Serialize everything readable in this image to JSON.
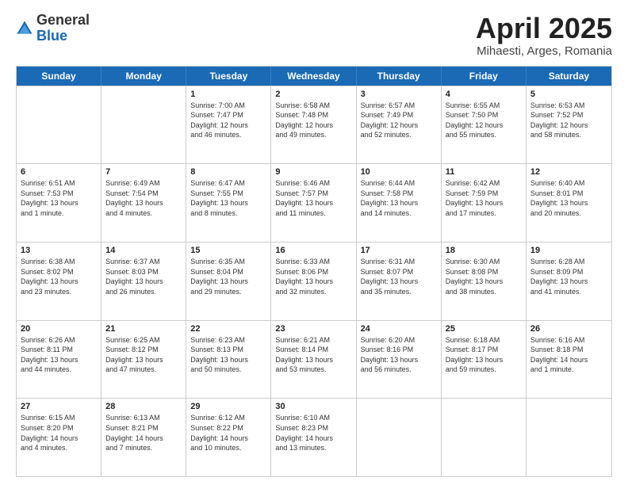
{
  "header": {
    "logo_general": "General",
    "logo_blue": "Blue",
    "month_title": "April 2025",
    "location": "Mihaesti, Arges, Romania"
  },
  "days_of_week": [
    "Sunday",
    "Monday",
    "Tuesday",
    "Wednesday",
    "Thursday",
    "Friday",
    "Saturday"
  ],
  "weeks": [
    [
      {
        "day": "",
        "empty": true
      },
      {
        "day": "",
        "empty": true
      },
      {
        "day": "1",
        "line1": "Sunrise: 7:00 AM",
        "line2": "Sunset: 7:47 PM",
        "line3": "Daylight: 12 hours",
        "line4": "and 46 minutes."
      },
      {
        "day": "2",
        "line1": "Sunrise: 6:58 AM",
        "line2": "Sunset: 7:48 PM",
        "line3": "Daylight: 12 hours",
        "line4": "and 49 minutes."
      },
      {
        "day": "3",
        "line1": "Sunrise: 6:57 AM",
        "line2": "Sunset: 7:49 PM",
        "line3": "Daylight: 12 hours",
        "line4": "and 52 minutes."
      },
      {
        "day": "4",
        "line1": "Sunrise: 6:55 AM",
        "line2": "Sunset: 7:50 PM",
        "line3": "Daylight: 12 hours",
        "line4": "and 55 minutes."
      },
      {
        "day": "5",
        "line1": "Sunrise: 6:53 AM",
        "line2": "Sunset: 7:52 PM",
        "line3": "Daylight: 12 hours",
        "line4": "and 58 minutes."
      }
    ],
    [
      {
        "day": "6",
        "line1": "Sunrise: 6:51 AM",
        "line2": "Sunset: 7:53 PM",
        "line3": "Daylight: 13 hours",
        "line4": "and 1 minute."
      },
      {
        "day": "7",
        "line1": "Sunrise: 6:49 AM",
        "line2": "Sunset: 7:54 PM",
        "line3": "Daylight: 13 hours",
        "line4": "and 4 minutes."
      },
      {
        "day": "8",
        "line1": "Sunrise: 6:47 AM",
        "line2": "Sunset: 7:55 PM",
        "line3": "Daylight: 13 hours",
        "line4": "and 8 minutes."
      },
      {
        "day": "9",
        "line1": "Sunrise: 6:46 AM",
        "line2": "Sunset: 7:57 PM",
        "line3": "Daylight: 13 hours",
        "line4": "and 11 minutes."
      },
      {
        "day": "10",
        "line1": "Sunrise: 6:44 AM",
        "line2": "Sunset: 7:58 PM",
        "line3": "Daylight: 13 hours",
        "line4": "and 14 minutes."
      },
      {
        "day": "11",
        "line1": "Sunrise: 6:42 AM",
        "line2": "Sunset: 7:59 PM",
        "line3": "Daylight: 13 hours",
        "line4": "and 17 minutes."
      },
      {
        "day": "12",
        "line1": "Sunrise: 6:40 AM",
        "line2": "Sunset: 8:01 PM",
        "line3": "Daylight: 13 hours",
        "line4": "and 20 minutes."
      }
    ],
    [
      {
        "day": "13",
        "line1": "Sunrise: 6:38 AM",
        "line2": "Sunset: 8:02 PM",
        "line3": "Daylight: 13 hours",
        "line4": "and 23 minutes."
      },
      {
        "day": "14",
        "line1": "Sunrise: 6:37 AM",
        "line2": "Sunset: 8:03 PM",
        "line3": "Daylight: 13 hours",
        "line4": "and 26 minutes."
      },
      {
        "day": "15",
        "line1": "Sunrise: 6:35 AM",
        "line2": "Sunset: 8:04 PM",
        "line3": "Daylight: 13 hours",
        "line4": "and 29 minutes."
      },
      {
        "day": "16",
        "line1": "Sunrise: 6:33 AM",
        "line2": "Sunset: 8:06 PM",
        "line3": "Daylight: 13 hours",
        "line4": "and 32 minutes."
      },
      {
        "day": "17",
        "line1": "Sunrise: 6:31 AM",
        "line2": "Sunset: 8:07 PM",
        "line3": "Daylight: 13 hours",
        "line4": "and 35 minutes."
      },
      {
        "day": "18",
        "line1": "Sunrise: 6:30 AM",
        "line2": "Sunset: 8:08 PM",
        "line3": "Daylight: 13 hours",
        "line4": "and 38 minutes."
      },
      {
        "day": "19",
        "line1": "Sunrise: 6:28 AM",
        "line2": "Sunset: 8:09 PM",
        "line3": "Daylight: 13 hours",
        "line4": "and 41 minutes."
      }
    ],
    [
      {
        "day": "20",
        "line1": "Sunrise: 6:26 AM",
        "line2": "Sunset: 8:11 PM",
        "line3": "Daylight: 13 hours",
        "line4": "and 44 minutes."
      },
      {
        "day": "21",
        "line1": "Sunrise: 6:25 AM",
        "line2": "Sunset: 8:12 PM",
        "line3": "Daylight: 13 hours",
        "line4": "and 47 minutes."
      },
      {
        "day": "22",
        "line1": "Sunrise: 6:23 AM",
        "line2": "Sunset: 8:13 PM",
        "line3": "Daylight: 13 hours",
        "line4": "and 50 minutes."
      },
      {
        "day": "23",
        "line1": "Sunrise: 6:21 AM",
        "line2": "Sunset: 8:14 PM",
        "line3": "Daylight: 13 hours",
        "line4": "and 53 minutes."
      },
      {
        "day": "24",
        "line1": "Sunrise: 6:20 AM",
        "line2": "Sunset: 8:16 PM",
        "line3": "Daylight: 13 hours",
        "line4": "and 56 minutes."
      },
      {
        "day": "25",
        "line1": "Sunrise: 6:18 AM",
        "line2": "Sunset: 8:17 PM",
        "line3": "Daylight: 13 hours",
        "line4": "and 59 minutes."
      },
      {
        "day": "26",
        "line1": "Sunrise: 6:16 AM",
        "line2": "Sunset: 8:18 PM",
        "line3": "Daylight: 14 hours",
        "line4": "and 1 minute."
      }
    ],
    [
      {
        "day": "27",
        "line1": "Sunrise: 6:15 AM",
        "line2": "Sunset: 8:20 PM",
        "line3": "Daylight: 14 hours",
        "line4": "and 4 minutes."
      },
      {
        "day": "28",
        "line1": "Sunrise: 6:13 AM",
        "line2": "Sunset: 8:21 PM",
        "line3": "Daylight: 14 hours",
        "line4": "and 7 minutes."
      },
      {
        "day": "29",
        "line1": "Sunrise: 6:12 AM",
        "line2": "Sunset: 8:22 PM",
        "line3": "Daylight: 14 hours",
        "line4": "and 10 minutes."
      },
      {
        "day": "30",
        "line1": "Sunrise: 6:10 AM",
        "line2": "Sunset: 8:23 PM",
        "line3": "Daylight: 14 hours",
        "line4": "and 13 minutes."
      },
      {
        "day": "",
        "empty": true
      },
      {
        "day": "",
        "empty": true
      },
      {
        "day": "",
        "empty": true
      }
    ]
  ]
}
